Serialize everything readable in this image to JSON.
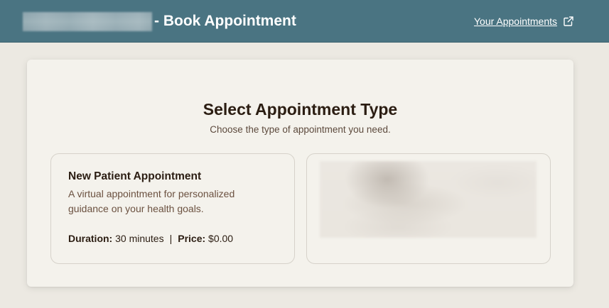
{
  "header": {
    "title": "- Book Appointment",
    "your_appointments_link": "Your Appointments",
    "external_link_icon": "external-link-icon",
    "background_color": "#4a7482"
  },
  "main": {
    "heading": "Select Appointment Type",
    "subheading": "Choose the type of appointment you need.",
    "cards": [
      {
        "title": "New Patient Appointment",
        "description": "A virtual appointment for personalized guidance on your health goals.",
        "duration_label": "Duration:",
        "duration_value": "30 minutes",
        "separator": "|",
        "price_label": "Price:",
        "price_value": "$0.00"
      }
    ]
  }
}
